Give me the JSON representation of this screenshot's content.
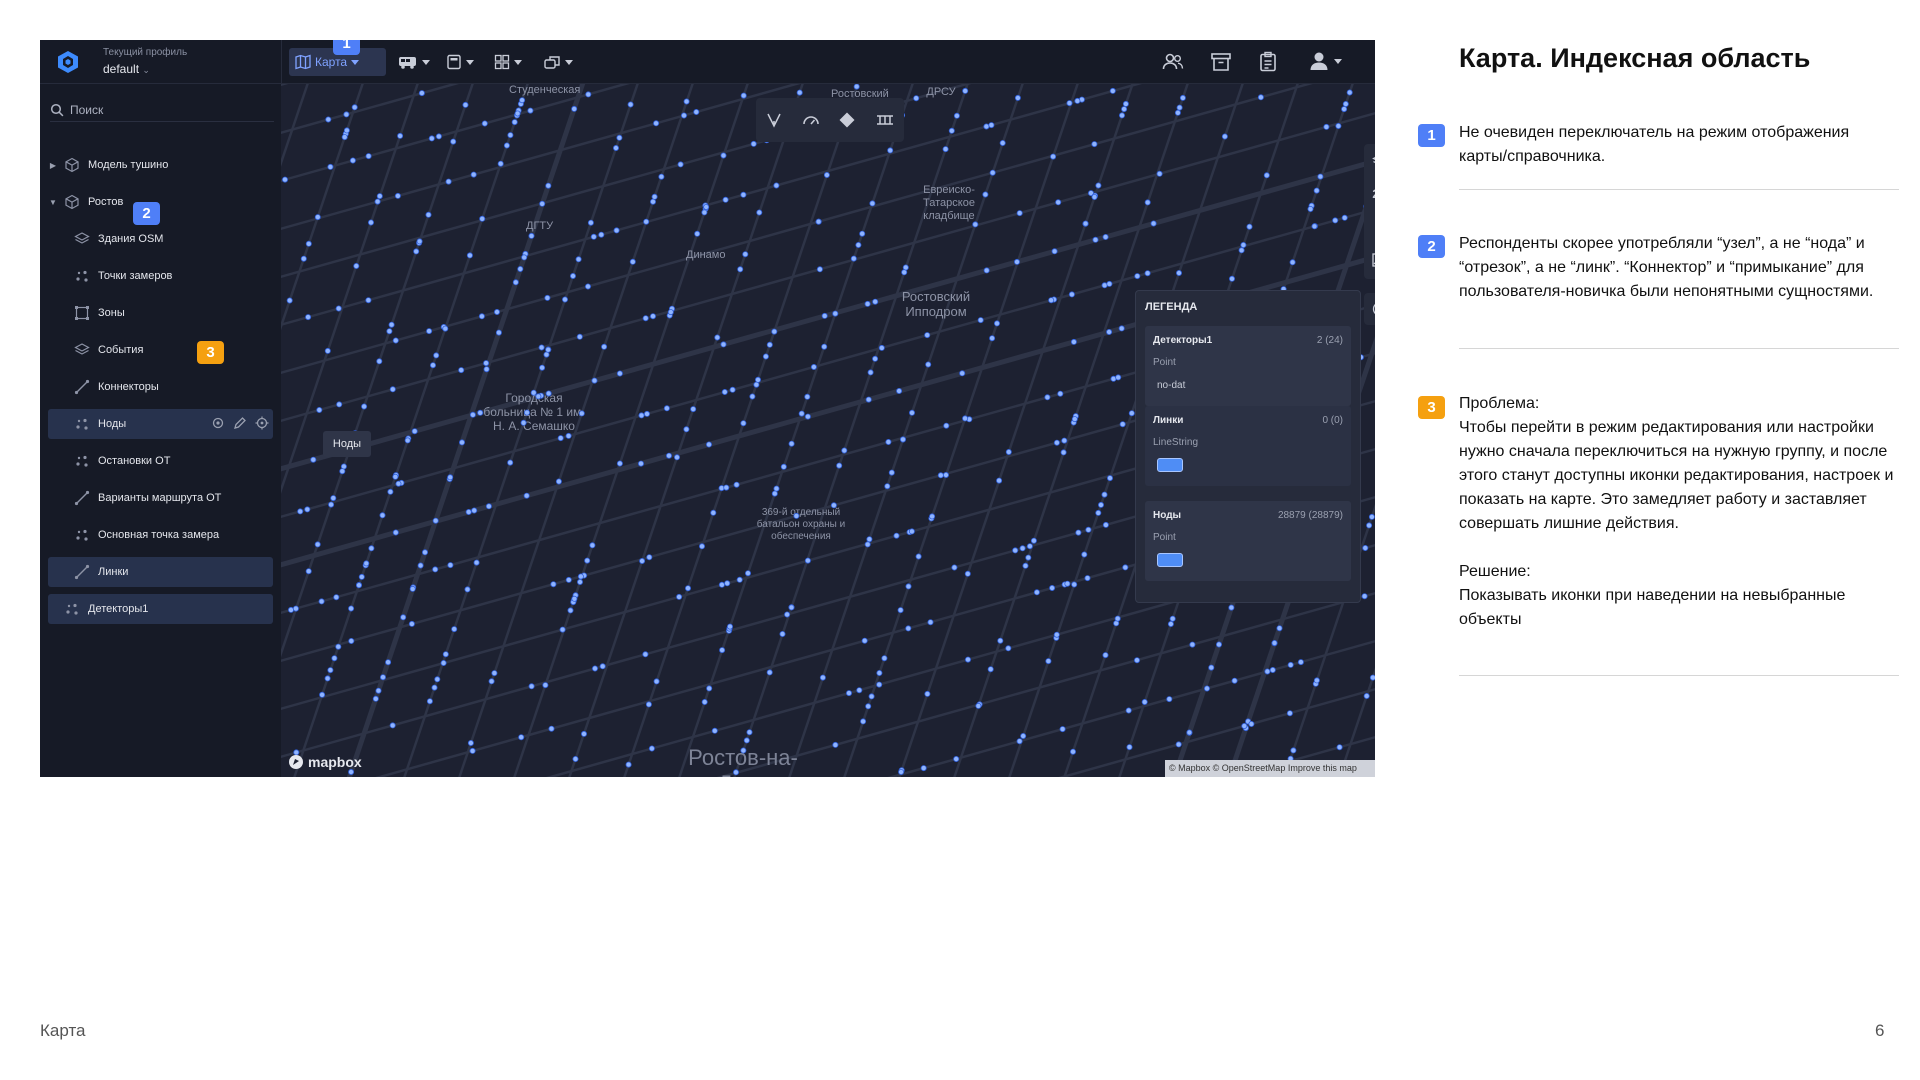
{
  "app": {
    "profile_caption": "Текущий профиль",
    "profile_value": "default"
  },
  "toolbar": {
    "map_label": "Карта"
  },
  "sidebar": {
    "search_placeholder": "Поиск",
    "items": [
      {
        "label": "Модель тушино",
        "icon": "cube-icon"
      },
      {
        "label": "Ростов",
        "icon": "cube-icon"
      },
      {
        "label": "Здания OSM",
        "icon": "layers-icon"
      },
      {
        "label": "Точки замеров",
        "icon": "points-icon"
      },
      {
        "label": "Зоны",
        "icon": "zone-icon"
      },
      {
        "label": "События",
        "icon": "layers-icon"
      },
      {
        "label": "Коннекторы",
        "icon": "line-icon"
      },
      {
        "label": "Ноды",
        "icon": "points-icon"
      },
      {
        "label": "Остановки ОТ",
        "icon": "points-icon"
      },
      {
        "label": "Варианты маршрута ОТ",
        "icon": "line-icon"
      },
      {
        "label": "Основная точка замера",
        "icon": "points-icon"
      },
      {
        "label": "Линки",
        "icon": "line-icon"
      },
      {
        "label": "Детекторы1",
        "icon": "points-icon"
      }
    ]
  },
  "map": {
    "tooltip": "Ноды",
    "labels": [
      "Ростовский",
      "Евреиско-Татарское кладбище",
      "ДГТУ",
      "Динамо",
      "Ростовский Ипподром",
      "Городская больница № 1 им. Н. А. Семашко",
      "369-й отдельный батальон охраны и обеспечения",
      "Ростов-на-Дону",
      "Студенческая",
      "ДРСУ"
    ],
    "mode_2d": "2D",
    "mapbox": "mapbox",
    "attribution": "© Mapbox © OpenStreetMap Improve this map"
  },
  "legend": {
    "title": "ЛЕГЕНДА",
    "entries": [
      {
        "name": "Детекторы1",
        "count": "2 (24)",
        "type": "Point",
        "broken": "no-dat"
      },
      {
        "name": "Линки",
        "count": "0 (0)",
        "type": "LineString"
      },
      {
        "name": "Ноды",
        "count": "28879 (28879)",
        "type": "Point"
      }
    ],
    "swatch_color": "#4f8df5"
  },
  "badges": [
    "1",
    "2",
    "3"
  ],
  "colors": {
    "badge_blue": "#4f7ff7",
    "badge_orange": "#f5a010",
    "node_dot": "#8fb4ff"
  },
  "notes": {
    "title": "Карта. Индексная область",
    "n1": "Не очевиден переключатель на режим отображения карты/справочника.",
    "n2": "Респонденты скорее употребляли “узел”, а не “нода” и “отрезок”, а не “линк”.  “Коннектор” и “примыкание” для пользователя-новичка были непонятными сущностями.",
    "n3_problem_label": "Проблема:",
    "n3_problem": "Чтобы перейти в режим редактирования или настройки нужно сначала переключиться на нужную группу, и после этого станут доступны иконки редактирования, настроек и показать на карте. Это замедляет работу и заставляет совершать лишние действия.",
    "n3_solution_label": "Решение:",
    "n3_solution": "Показывать иконки при наведении на невыбранные объекты"
  },
  "footer": {
    "left": "Карта",
    "page": "6"
  }
}
